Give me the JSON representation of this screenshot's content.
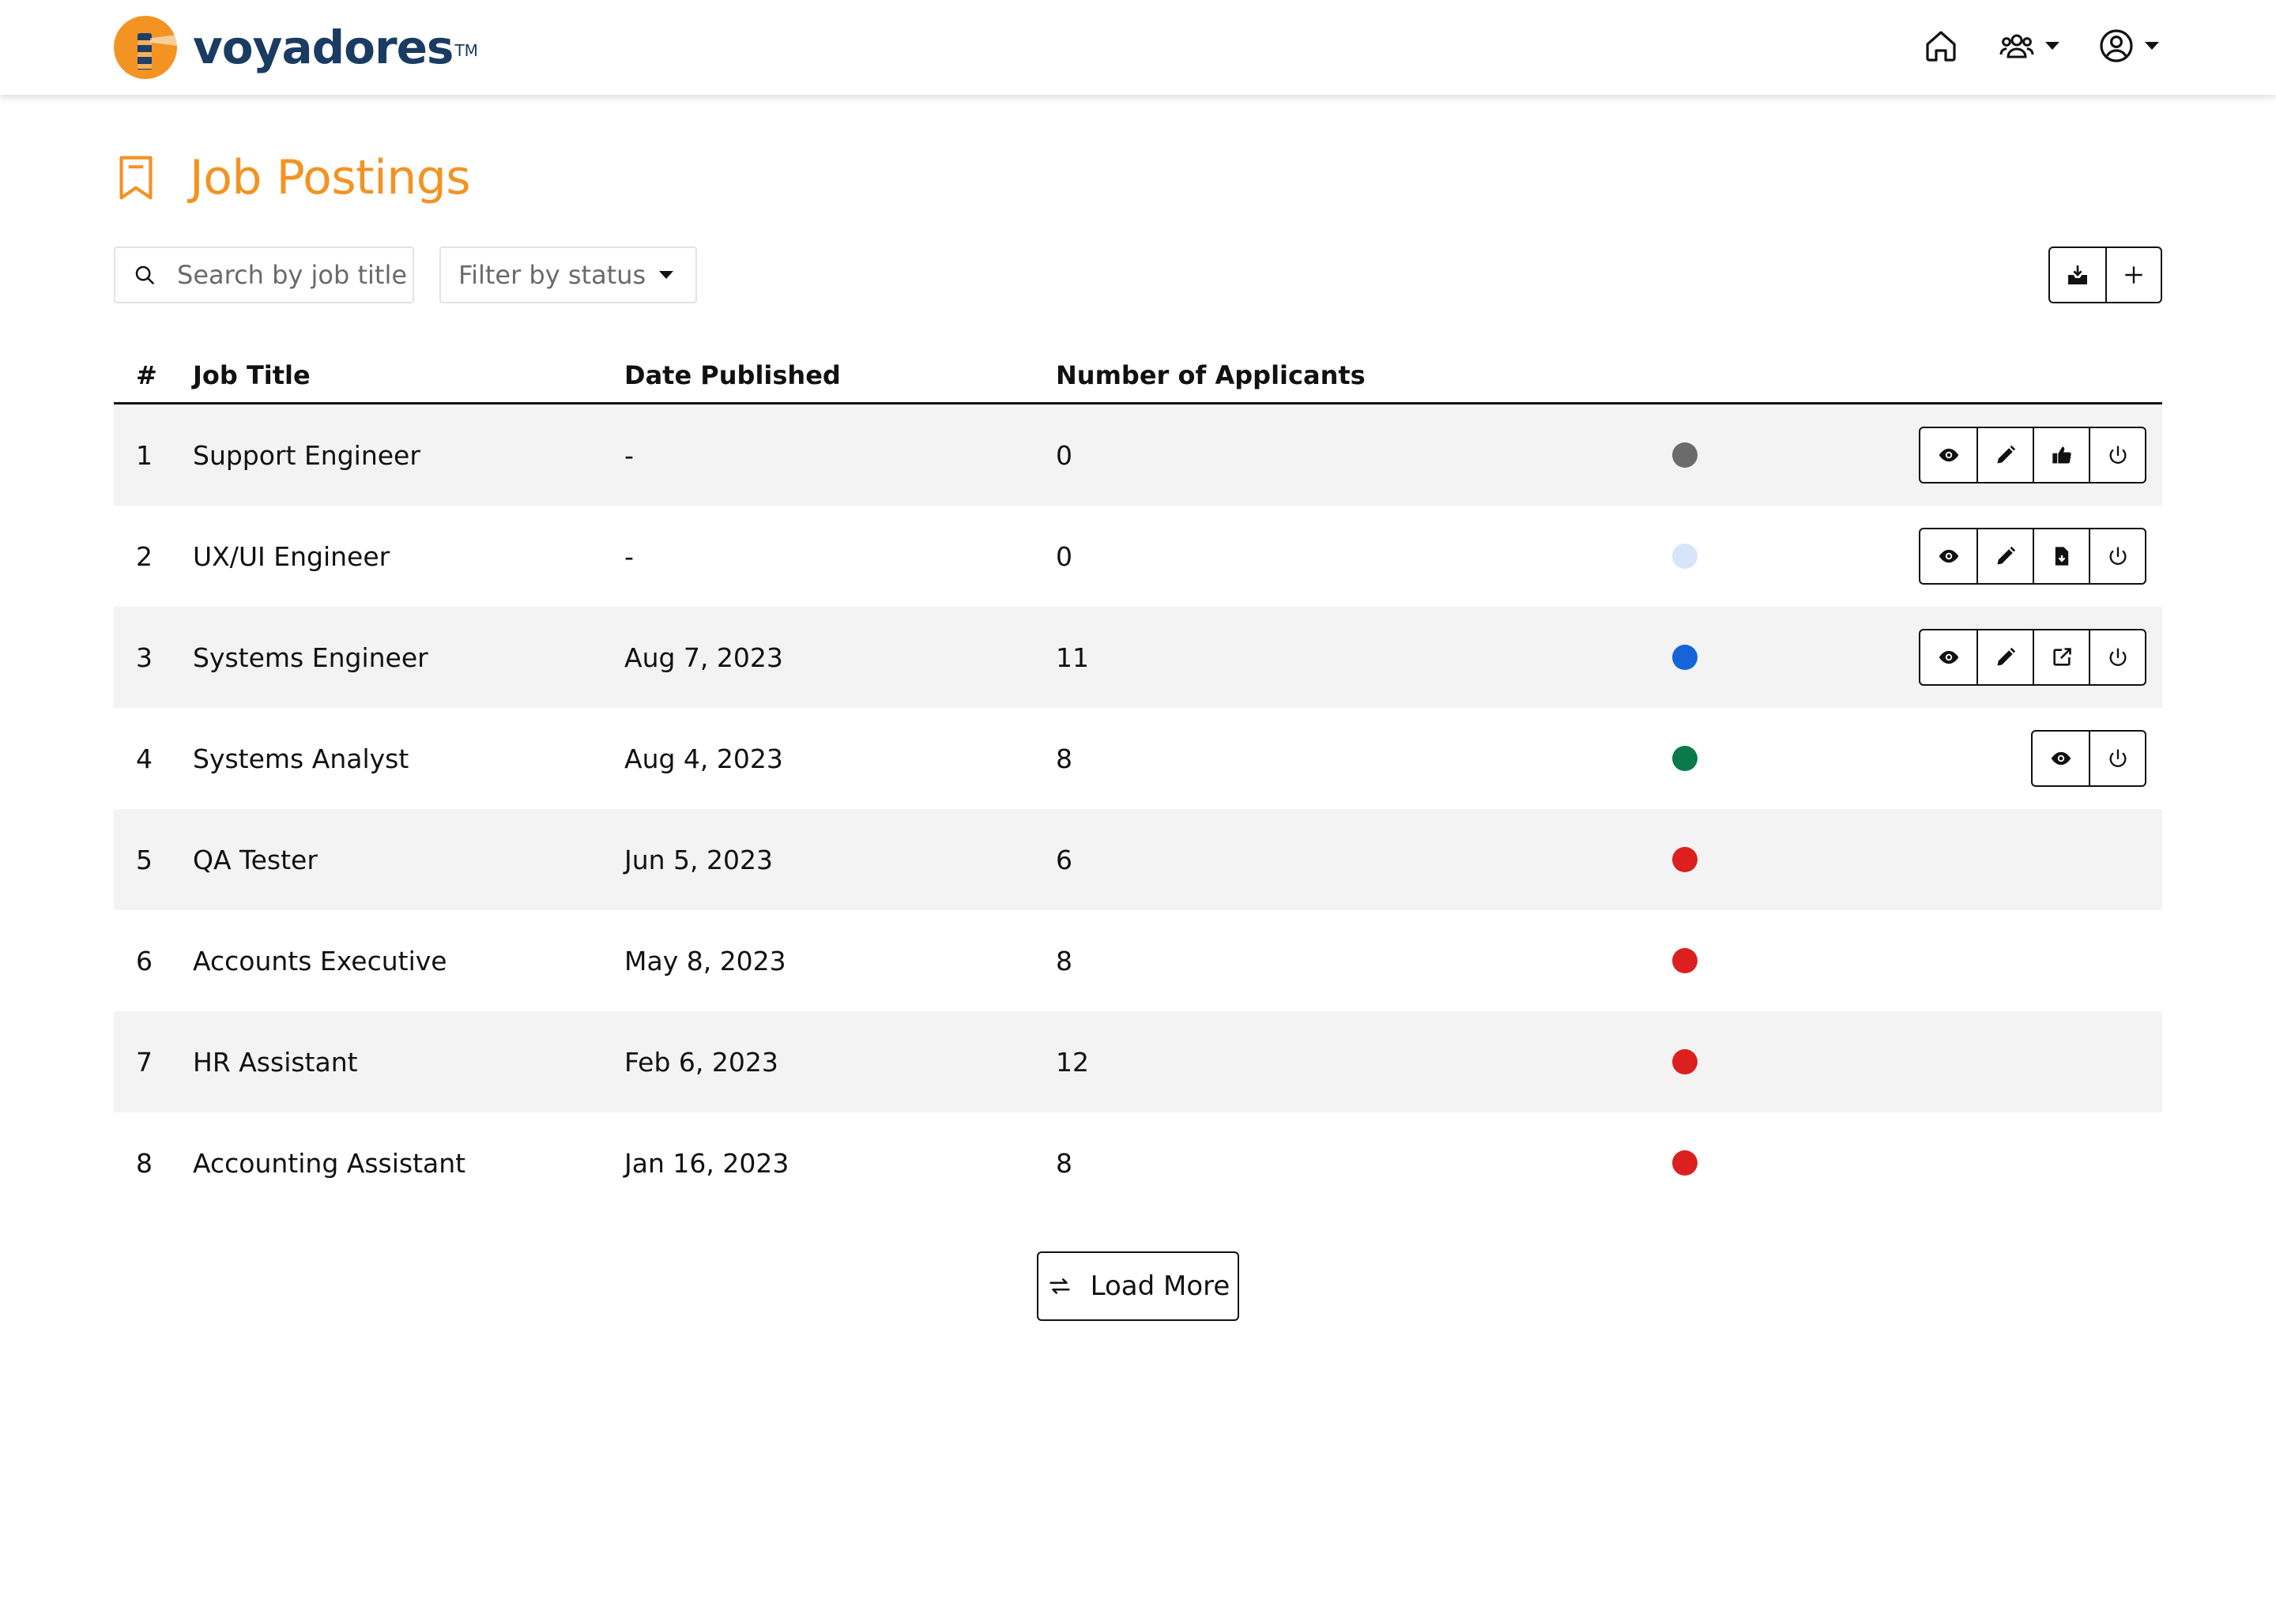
{
  "brand": {
    "name": "voyadores",
    "tm": "TM",
    "accent": "#f39322",
    "navy": "#1a3c63"
  },
  "header": {
    "icons": [
      "home-icon",
      "users-icon",
      "account-icon"
    ]
  },
  "page": {
    "title": "Job Postings"
  },
  "toolbar": {
    "search_placeholder": "Search by job title",
    "filter_label": "Filter by status",
    "buttons": [
      "download-icon",
      "plus-icon"
    ]
  },
  "table": {
    "headers": {
      "num": "#",
      "title": "Job Title",
      "date": "Date Published",
      "applicants": "Number of Applicants"
    },
    "rows": [
      {
        "num": "1",
        "title": "Support Engineer",
        "date": "-",
        "applicants": "0",
        "status_color": "#6b6b6b",
        "actions": [
          "view",
          "edit",
          "approve",
          "power"
        ]
      },
      {
        "num": "2",
        "title": "UX/UI Engineer",
        "date": "-",
        "applicants": "0",
        "status_color": "#d7e5fb",
        "actions": [
          "view",
          "edit",
          "publish",
          "power"
        ]
      },
      {
        "num": "3",
        "title": "Systems Engineer",
        "date": "Aug 7, 2023",
        "applicants": "11",
        "status_color": "#1565d8",
        "actions": [
          "view",
          "edit",
          "open-external",
          "power"
        ]
      },
      {
        "num": "4",
        "title": "Systems Analyst",
        "date": "Aug 4, 2023",
        "applicants": "8",
        "status_color": "#0b7a4b",
        "actions": [
          "view",
          "power"
        ]
      },
      {
        "num": "5",
        "title": "QA Tester",
        "date": "Jun 5, 2023",
        "applicants": "6",
        "status_color": "#dc1f1f",
        "actions": []
      },
      {
        "num": "6",
        "title": "Accounts Executive",
        "date": "May 8, 2023",
        "applicants": "8",
        "status_color": "#dc1f1f",
        "actions": []
      },
      {
        "num": "7",
        "title": "HR Assistant",
        "date": "Feb 6, 2023",
        "applicants": "12",
        "status_color": "#dc1f1f",
        "actions": []
      },
      {
        "num": "8",
        "title": "Accounting Assistant",
        "date": "Jan 16, 2023",
        "applicants": "8",
        "status_color": "#dc1f1f",
        "actions": []
      }
    ]
  },
  "load_more": {
    "label": "Load More"
  }
}
